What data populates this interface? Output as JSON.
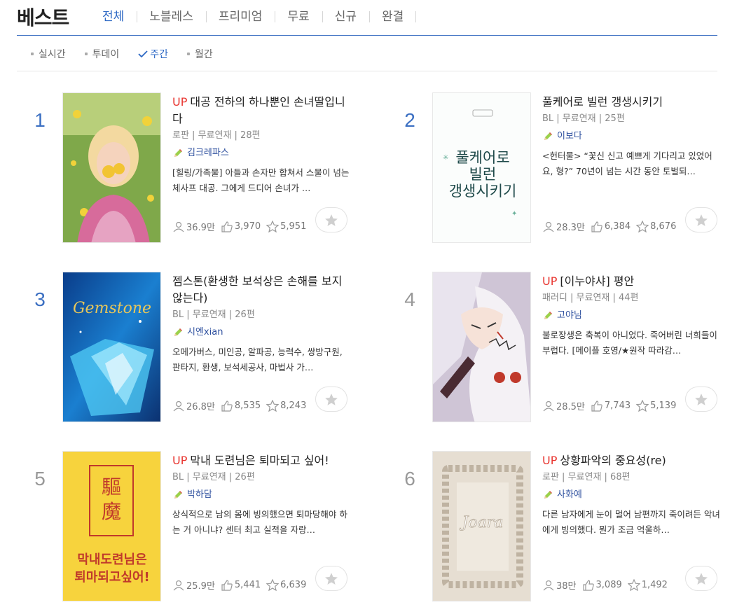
{
  "header": {
    "title": "베스트",
    "tabs": [
      {
        "label": "전체",
        "active": true
      },
      {
        "label": "노블레스"
      },
      {
        "label": "프리미엄"
      },
      {
        "label": "무료"
      },
      {
        "label": "신규"
      },
      {
        "label": "완결"
      }
    ]
  },
  "subtabs": [
    {
      "label": "실시간"
    },
    {
      "label": "투데이"
    },
    {
      "label": "주간",
      "active": true
    },
    {
      "label": "월간"
    }
  ],
  "novels": [
    {
      "rank": "1",
      "up": "UP",
      "title": "대공 전하의 하나뿐인 손녀딸입니다",
      "meta": "로판 | 무료연재 | 28편",
      "author": "김크레파스",
      "desc": "[힐링/가족물] 아들과 손자만 합쳐서 스물이 넘는 체사프 대공. 그에게 드디어 손녀가 …",
      "views": "36.9만",
      "likes": "3,970",
      "stars": "5,951"
    },
    {
      "rank": "2",
      "up": "",
      "title": "풀케어로 빌런 갱생시키기",
      "meta": "BL | 무료연재 | 25편",
      "author": "이보다",
      "desc": "<헌터물> “꽃신 신고 예쁘게 기다리고 있었어요, 형?” 70년이 넘는 시간 동안 토벌되…",
      "views": "28.3만",
      "likes": "6,384",
      "stars": "8,676",
      "cover_text": "풀케어로 빌런 갱생시키기"
    },
    {
      "rank": "3",
      "up": "",
      "title": "젬스톤(환생한 보석상은 손해를 보지 않는다)",
      "meta": "BL | 무료연재 | 26편",
      "author": "시엔xian",
      "desc": "오메가버스, 미인공, 알파공, 능력수, 쌍방구원, 판타지, 환생, 보석세공사, 마법사 가…",
      "views": "26.8만",
      "likes": "8,535",
      "stars": "8,243",
      "cover_text": "Gemstone"
    },
    {
      "rank": "4",
      "up": "UP",
      "title": "[이누야샤] 평안",
      "meta": "패러디 | 무료연재 | 44편",
      "author": "고야님",
      "desc": "불로장생은 축복이 아니었다. 죽어버린 너희들이 부럽다. [메이플 호영/★원작 따라감…",
      "views": "28.5만",
      "likes": "7,743",
      "stars": "5,139"
    },
    {
      "rank": "5",
      "up": "UP",
      "title": "막내 도련님은 퇴마되고 싶어!",
      "meta": "BL | 무료연재 | 26편",
      "author": "박하담",
      "desc": "상식적으로 남의 몸에 빙의했으면 퇴마당해야 하는 거 아니냐? 센터 최고 실적을 자랑…",
      "views": "25.9만",
      "likes": "5,441",
      "stars": "6,639",
      "cover_text": "驅魔",
      "cover_text2": "막내도련님은 퇴마되고싶어!"
    },
    {
      "rank": "6",
      "up": "UP",
      "title": "상황파악의 중요성(re)",
      "meta": "로판 | 무료연재 | 68편",
      "author": "사화예",
      "desc": "다른 남자에게 눈이 멀어 남편까지 죽이려든 악녀에게 빙의했다. 뭔가 조금 억울하…",
      "views": "38만",
      "likes": "3,089",
      "stars": "1,492",
      "cover_text": "Joara"
    }
  ],
  "colors": {
    "accent": "#2d68c4",
    "up": "#e8342f",
    "rank_blue": "#3b6fc2",
    "rank_gray": "#999999"
  }
}
